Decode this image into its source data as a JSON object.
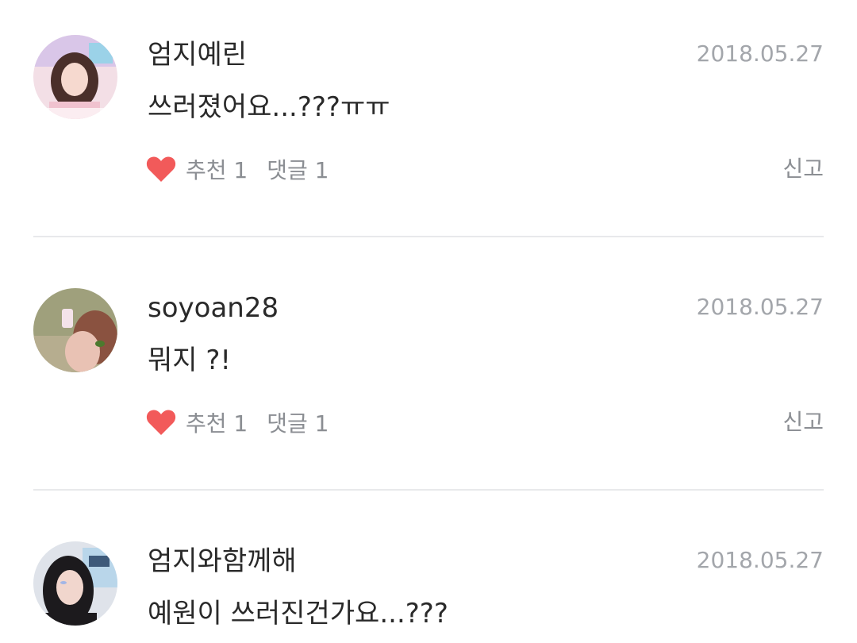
{
  "comments": [
    {
      "username": "엄지예린",
      "date": "2018.05.27",
      "text": "쓰러졌어요...???ㅠㅠ",
      "recommend_label": "추천 1",
      "reply_label": "댓글 1",
      "report_label": "신고"
    },
    {
      "username": "soyoan28",
      "date": "2018.05.27",
      "text": "뭐지 ?!",
      "recommend_label": "추천 1",
      "reply_label": "댓글 1",
      "report_label": "신고"
    },
    {
      "username": "엄지와함께해",
      "date": "2018.05.27",
      "text": "예원이 쓰러진건가요...???"
    }
  ],
  "colors": {
    "heart": "#f25a5a",
    "text": "#2a2a2a",
    "muted": "#8b8e93",
    "date": "#a3a6ab",
    "divider": "#e8e9eb"
  }
}
